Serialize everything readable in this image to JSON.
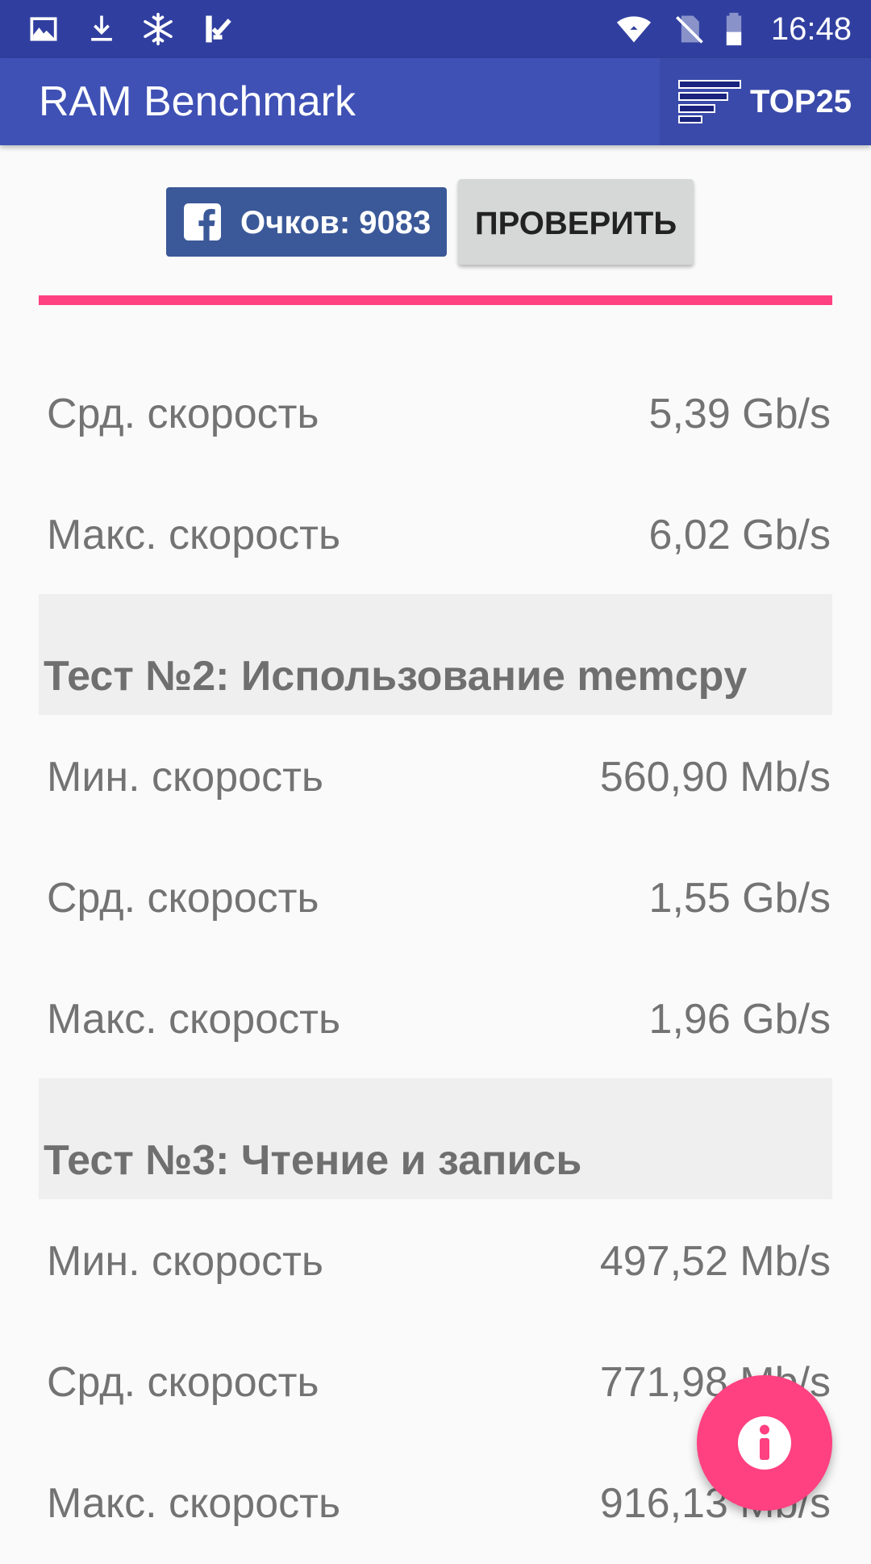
{
  "status_bar": {
    "time": "16:48",
    "icons": [
      "image-icon",
      "download-icon",
      "snowflake-icon",
      "checklist-icon",
      "wifi-icon",
      "no-sim-icon",
      "battery-icon"
    ]
  },
  "app_bar": {
    "title": "RAM Benchmark",
    "top_button_label": "TOP25",
    "top_button_icon": "sort-icon"
  },
  "actions": {
    "score_label": "Очков: 9083",
    "score_icon": "facebook-icon",
    "check_label": "ПРОВЕРИТЬ"
  },
  "colors": {
    "status_bar": "#303f9f",
    "app_bar": "#3f51b5",
    "accent": "#ff4081",
    "facebook": "#3b5998"
  },
  "test1": {
    "avg_label": "Срд. скорость",
    "avg_value": "5,39 Gb/s",
    "max_label": "Макс. скорость",
    "max_value": "6,02 Gb/s"
  },
  "test2": {
    "title": "Тест №2: Использование memcpy",
    "min_label": "Мин. скорость",
    "min_value": "560,90 Mb/s",
    "avg_label": "Срд. скорость",
    "avg_value": "1,55 Gb/s",
    "max_label": "Макс. скорость",
    "max_value": "1,96 Gb/s"
  },
  "test3": {
    "title": "Тест №3: Чтение и запись",
    "min_label": "Мин. скорость",
    "min_value": "497,52 Mb/s",
    "avg_label": "Срд. скорость",
    "avg_value": "771,98 Mb/s",
    "max_label": "Макс. скорость",
    "max_value": "916,13 Mb/s"
  },
  "fab": {
    "icon": "info-icon"
  }
}
